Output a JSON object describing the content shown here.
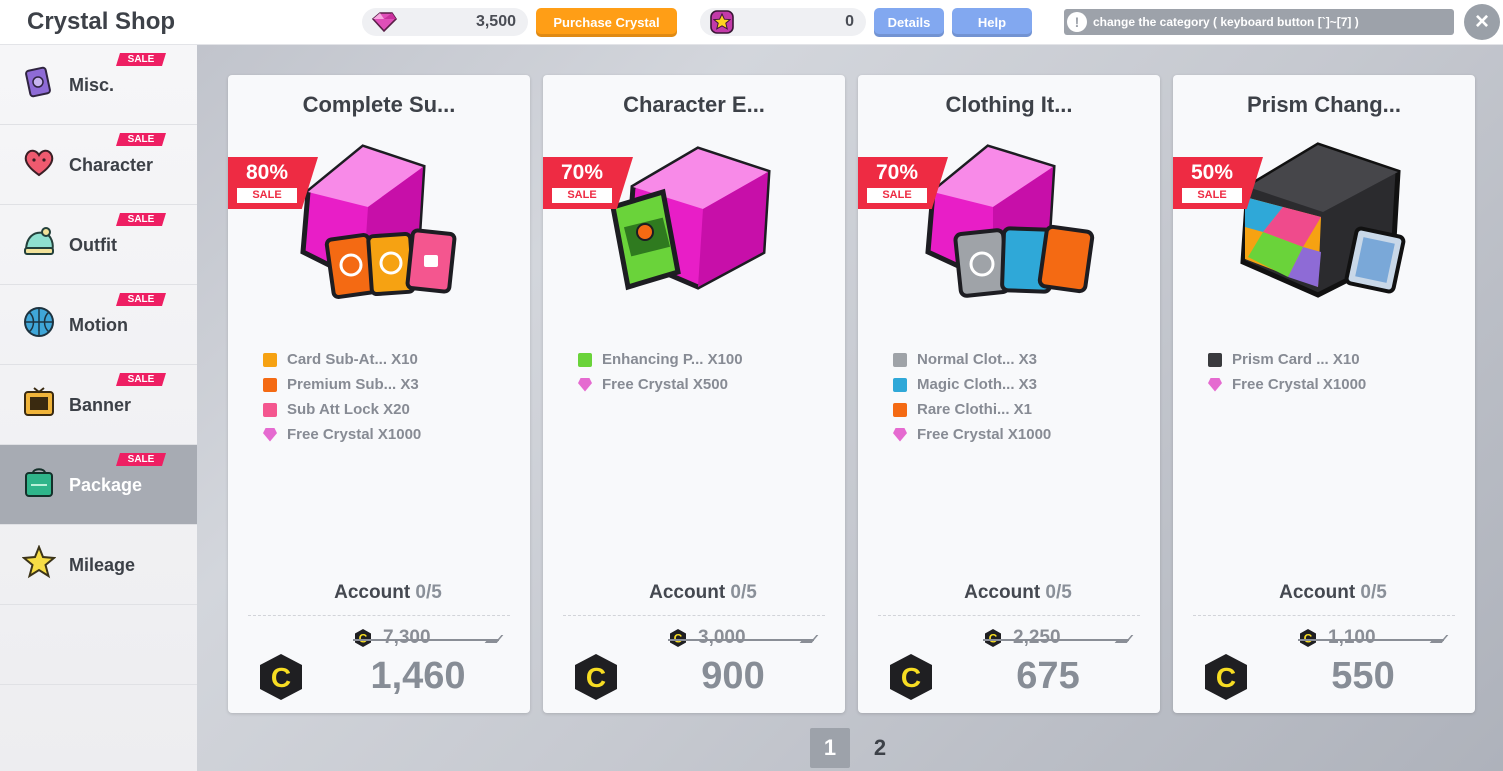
{
  "header": {
    "title": "Crystal Shop",
    "crystal_balance": "3,500",
    "purchase_label": "Purchase Crystal",
    "star_balance": "0",
    "details_label": "Details",
    "help_label": "Help",
    "notice": "change the category ( keyboard button [`]~[7] )",
    "notice_icon": "!",
    "close_icon": "×"
  },
  "sidebar": {
    "sale_badge": "SALE",
    "items": [
      {
        "label": "Misc.",
        "icon": "card-icon",
        "sale": true,
        "active": false
      },
      {
        "label": "Character",
        "icon": "heart-icon",
        "sale": true,
        "active": false
      },
      {
        "label": "Outfit",
        "icon": "beanie-icon",
        "sale": true,
        "active": false
      },
      {
        "label": "Motion",
        "icon": "basketball-icon",
        "sale": true,
        "active": false
      },
      {
        "label": "Banner",
        "icon": "banner-icon",
        "sale": true,
        "active": false
      },
      {
        "label": "Package",
        "icon": "bag-icon",
        "sale": true,
        "active": true
      },
      {
        "label": "Mileage",
        "icon": "star-icon",
        "sale": false,
        "active": false
      }
    ]
  },
  "cards": [
    {
      "title": "Complete Su...",
      "discount": "80%",
      "sale": "SALE",
      "items": [
        "Card Sub-At... X10",
        "Premium Sub... X3",
        "Sub Att Lock X20",
        "Free Crystal X1000"
      ],
      "account_label": "Account",
      "account_count": "0/5",
      "original_price": "7,300",
      "price": "1,460"
    },
    {
      "title": "Character E...",
      "discount": "70%",
      "sale": "SALE",
      "items": [
        "Enhancing P... X100",
        "Free Crystal X500"
      ],
      "account_label": "Account",
      "account_count": "0/5",
      "original_price": "3,000",
      "price": "900"
    },
    {
      "title": "Clothing It...",
      "discount": "70%",
      "sale": "SALE",
      "items": [
        "Normal Clot... X3",
        "Magic Cloth... X3",
        "Rare Clothi... X1",
        "Free Crystal X1000"
      ],
      "account_label": "Account",
      "account_count": "0/5",
      "original_price": "2,250",
      "price": "675"
    },
    {
      "title": "Prism Chang...",
      "discount": "50%",
      "sale": "SALE",
      "items": [
        "Prism Card ... X10",
        "Free Crystal X1000"
      ],
      "account_label": "Account",
      "account_count": "0/5",
      "original_price": "1,100",
      "price": "550"
    }
  ],
  "pagination": {
    "pages": [
      "1",
      "2"
    ],
    "current": "1"
  },
  "colors": {
    "accent_orange": "#ff9e16",
    "button_blue": "#82a8f0",
    "sale_pink": "#ee1f63",
    "discount_red": "#ee2b43"
  }
}
